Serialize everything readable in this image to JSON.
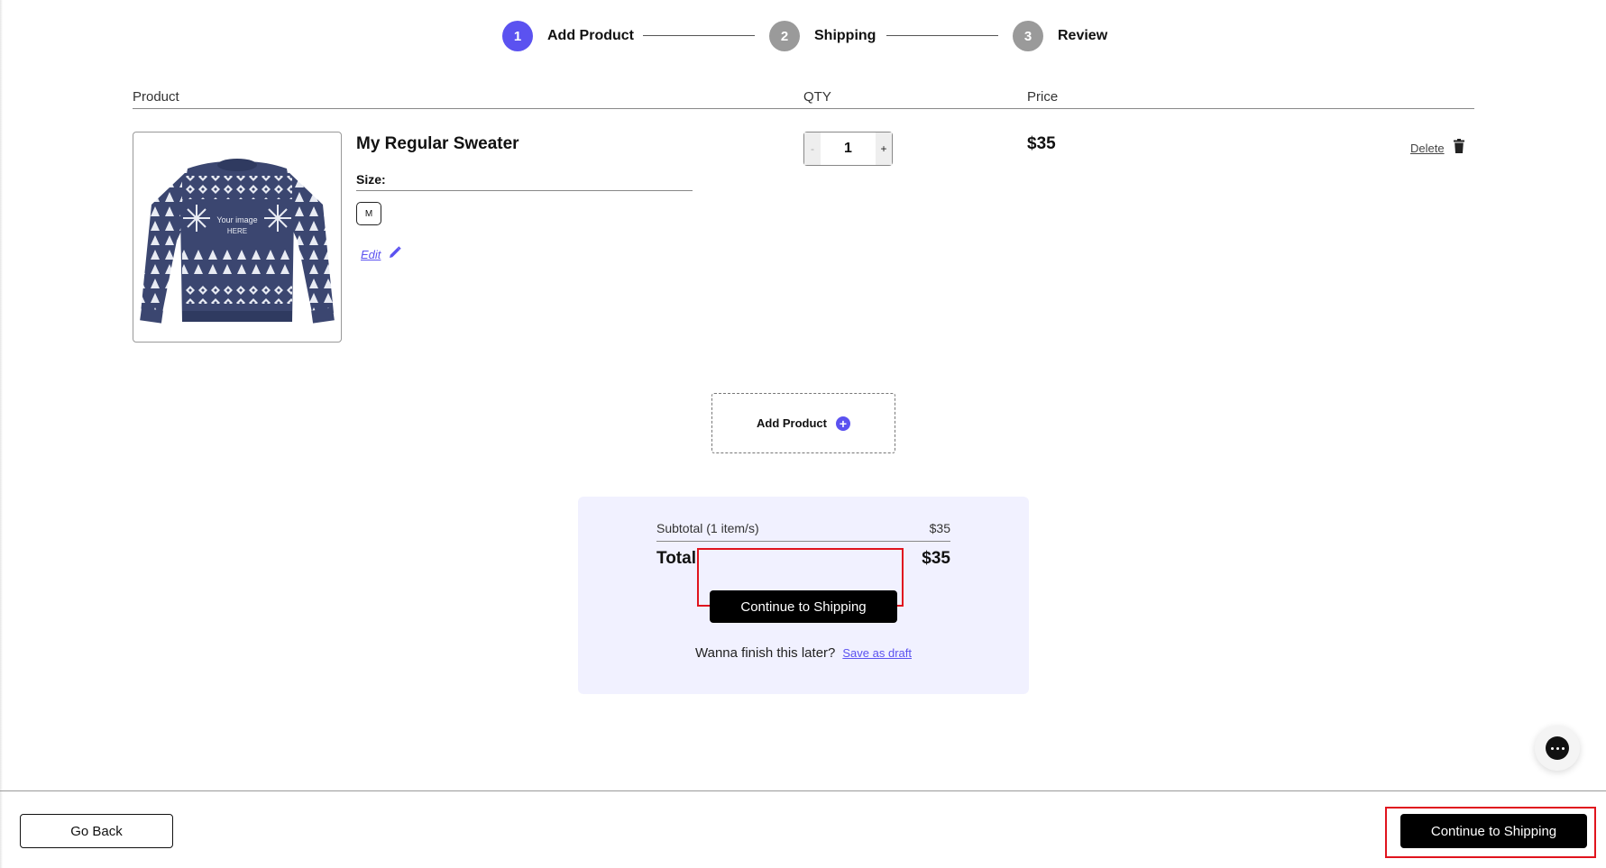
{
  "stepper": {
    "steps": [
      {
        "number": "1",
        "label": "Add Product",
        "state": "active"
      },
      {
        "number": "2",
        "label": "Shipping",
        "state": "inactive"
      },
      {
        "number": "3",
        "label": "Review",
        "state": "inactive"
      }
    ]
  },
  "table": {
    "headers": {
      "product": "Product",
      "qty": "QTY",
      "price": "Price"
    }
  },
  "item": {
    "name": "My Regular Sweater",
    "size_label": "Size:",
    "size_value": "M",
    "edit_label": "Edit",
    "quantity": "1",
    "qty_minus": "-",
    "qty_plus": "+",
    "price": "$35",
    "delete_label": "Delete",
    "image_overlay_text": [
      "Your image",
      "HERE"
    ]
  },
  "add_product": {
    "label": "Add Product",
    "icon": "plus-circle-icon"
  },
  "summary": {
    "subtotal_label": "Subtotal (1 item/s)",
    "subtotal_value": "$35",
    "total_label": "Total",
    "total_value": "$35",
    "continue_label": "Continue to Shipping",
    "later_text": "Wanna finish this later?",
    "save_draft_label": "Save as draft"
  },
  "footer": {
    "back_label": "Go Back",
    "continue_label": "Continue to Shipping"
  },
  "colors": {
    "accent": "#5b52f0",
    "step_inactive": "#9a9a9a",
    "summary_bg": "#f1f1ff",
    "highlight": "#e0141e"
  },
  "chat": {
    "icon": "chat-bubble-icon"
  }
}
